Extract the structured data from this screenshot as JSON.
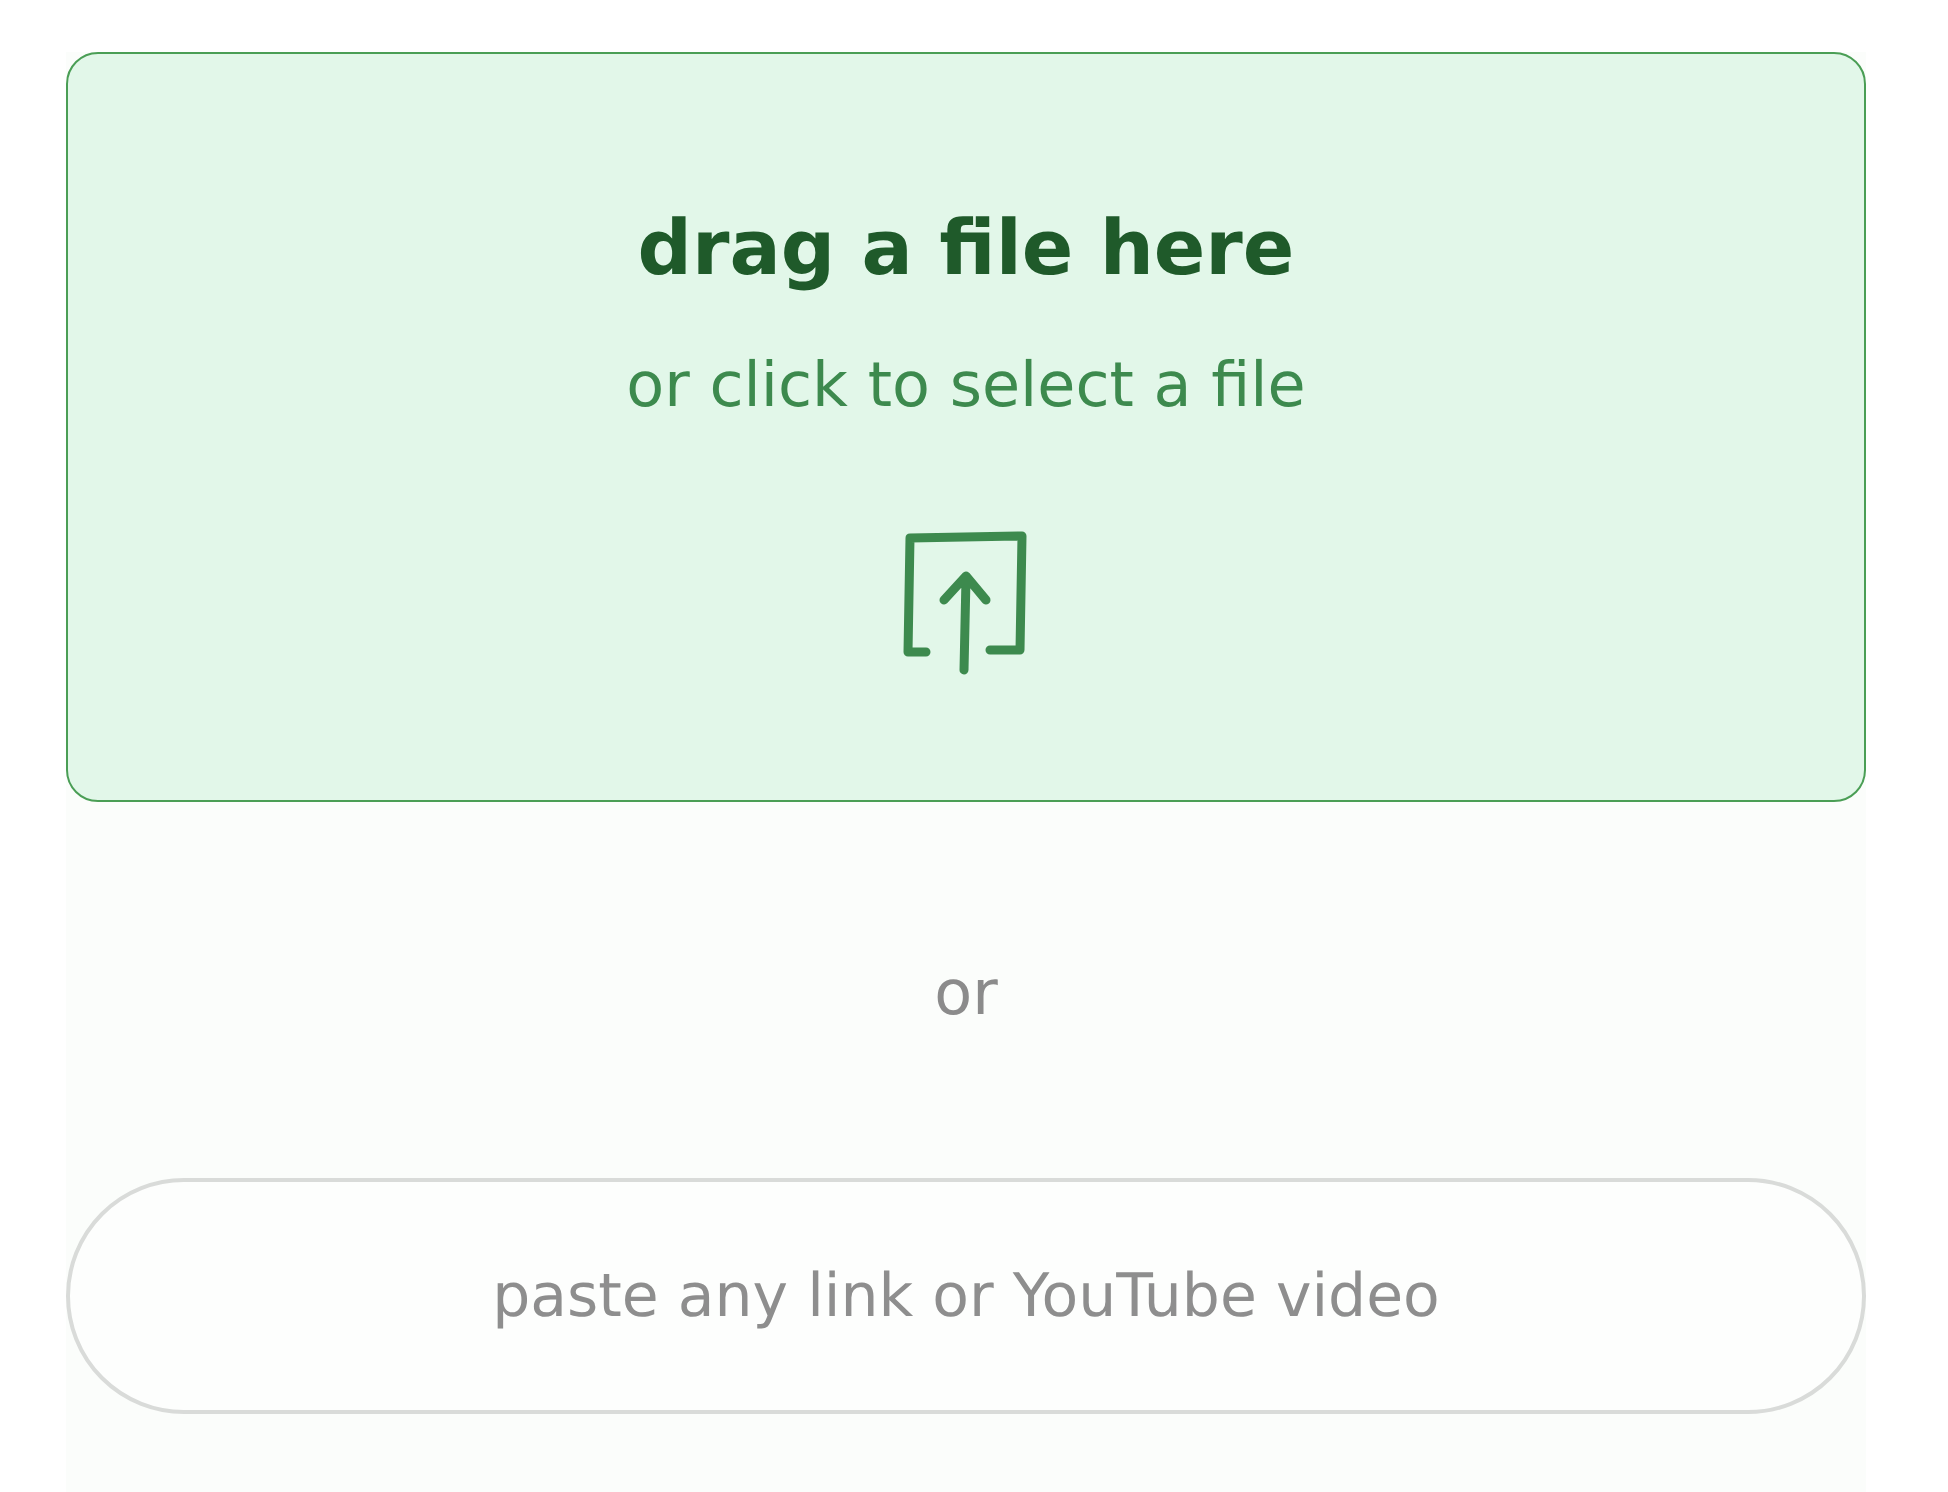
{
  "dropzone": {
    "title": "drag a file here",
    "subtitle": "or click to select a file"
  },
  "separator": "or",
  "link_field": {
    "placeholder": "paste any link or YouTube video"
  }
}
